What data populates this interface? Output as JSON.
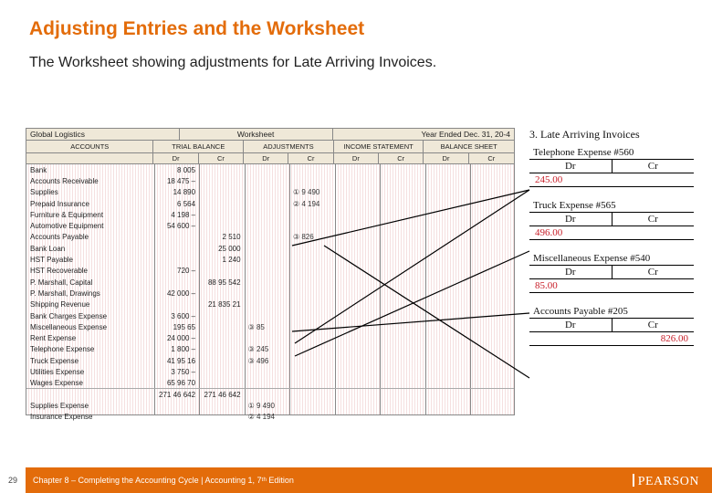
{
  "title": "Adjusting Entries and the Worksheet",
  "subtitle": "The Worksheet showing adjustments for Late Arriving Invoices.",
  "worksheet": {
    "header": {
      "left": "Global Logistics",
      "center": "Worksheet",
      "right": "Year Ended Dec. 31, 20-4"
    },
    "sections": {
      "acc": "ACCOUNTS",
      "tb": "TRIAL BALANCE",
      "adj": "ADJUSTMENTS",
      "is": "INCOME STATEMENT",
      "bs": "BALANCE SHEET"
    },
    "drcr": {
      "dr": "Dr",
      "cr": "Cr"
    },
    "rows": [
      {
        "name": "Bank",
        "tb_dr": "8 005"
      },
      {
        "name": "Accounts Receivable",
        "tb_dr": "18 475 –"
      },
      {
        "name": "Supplies",
        "tb_dr": "14 890",
        "adj_cr": "① 9 490"
      },
      {
        "name": "Prepaid Insurance",
        "tb_dr": "6 564",
        "adj_cr": "② 4 194"
      },
      {
        "name": "Furniture & Equipment",
        "tb_dr": "4 198 –"
      },
      {
        "name": "Automotive Equipment",
        "tb_dr": "54 600 –"
      },
      {
        "name": "Accounts Payable",
        "tb_cr": "2 510",
        "adj_cr": "③ 826"
      },
      {
        "name": "Bank Loan",
        "tb_cr": "25 000"
      },
      {
        "name": "HST Payable",
        "tb_cr": "1 240"
      },
      {
        "name": "HST Recoverable",
        "tb_dr": "720 –"
      },
      {
        "name": "P. Marshall, Capital",
        "tb_cr": "88 95 542"
      },
      {
        "name": "P. Marshall, Drawings",
        "tb_dr": "42 000 –"
      },
      {
        "name": "Shipping Revenue",
        "tb_cr": "21 835 21"
      },
      {
        "name": "Bank Charges Expense",
        "tb_dr": "3 600 –"
      },
      {
        "name": "Miscellaneous Expense",
        "tb_dr": "195 65",
        "adj_dr": "③ 85"
      },
      {
        "name": "Rent Expense",
        "tb_dr": "24 000 –"
      },
      {
        "name": "Telephone Expense",
        "tb_dr": "1 800 –",
        "adj_dr": "③ 245"
      },
      {
        "name": "Truck Expense",
        "tb_dr": "41 95 16",
        "adj_dr": "③ 496"
      },
      {
        "name": "Utilities Expense",
        "tb_dr": "3 750 –"
      },
      {
        "name": "Wages Expense",
        "tb_dr": "65 96 70"
      },
      {
        "name": "",
        "tb_dr": "271 46 642",
        "tb_cr": "271 46 642"
      },
      {
        "name": "Supplies Expense",
        "adj_dr": "① 9 490"
      },
      {
        "name": "Insurance Expense",
        "adj_dr": "② 4 194"
      }
    ]
  },
  "side": {
    "heading": "3. Late Arriving Invoices",
    "entries": [
      {
        "name": "Telephone Expense #560",
        "dr_label": "Dr",
        "cr_label": "Cr",
        "dr_amt": "245.00",
        "cr_amt": "",
        "red_side": "dr"
      },
      {
        "name": "Truck Expense #565",
        "dr_label": "Dr",
        "cr_label": "Cr",
        "dr_amt": "496.00",
        "cr_amt": "",
        "red_side": "dr"
      },
      {
        "name": "Miscellaneous Expense #540",
        "dr_label": "Dr",
        "cr_label": "Cr",
        "dr_amt": "85.00",
        "cr_amt": "",
        "red_side": "dr"
      },
      {
        "name": "Accounts Payable #205",
        "dr_label": "Dr",
        "cr_label": "Cr",
        "dr_amt": "",
        "cr_amt": "826.00",
        "red_side": "cr"
      }
    ]
  },
  "footer": {
    "page": "29",
    "text": "Chapter 8 – Completing the Accounting Cycle | Accounting 1, 7ᵗʰ Edition",
    "brand": "PEARSON"
  }
}
